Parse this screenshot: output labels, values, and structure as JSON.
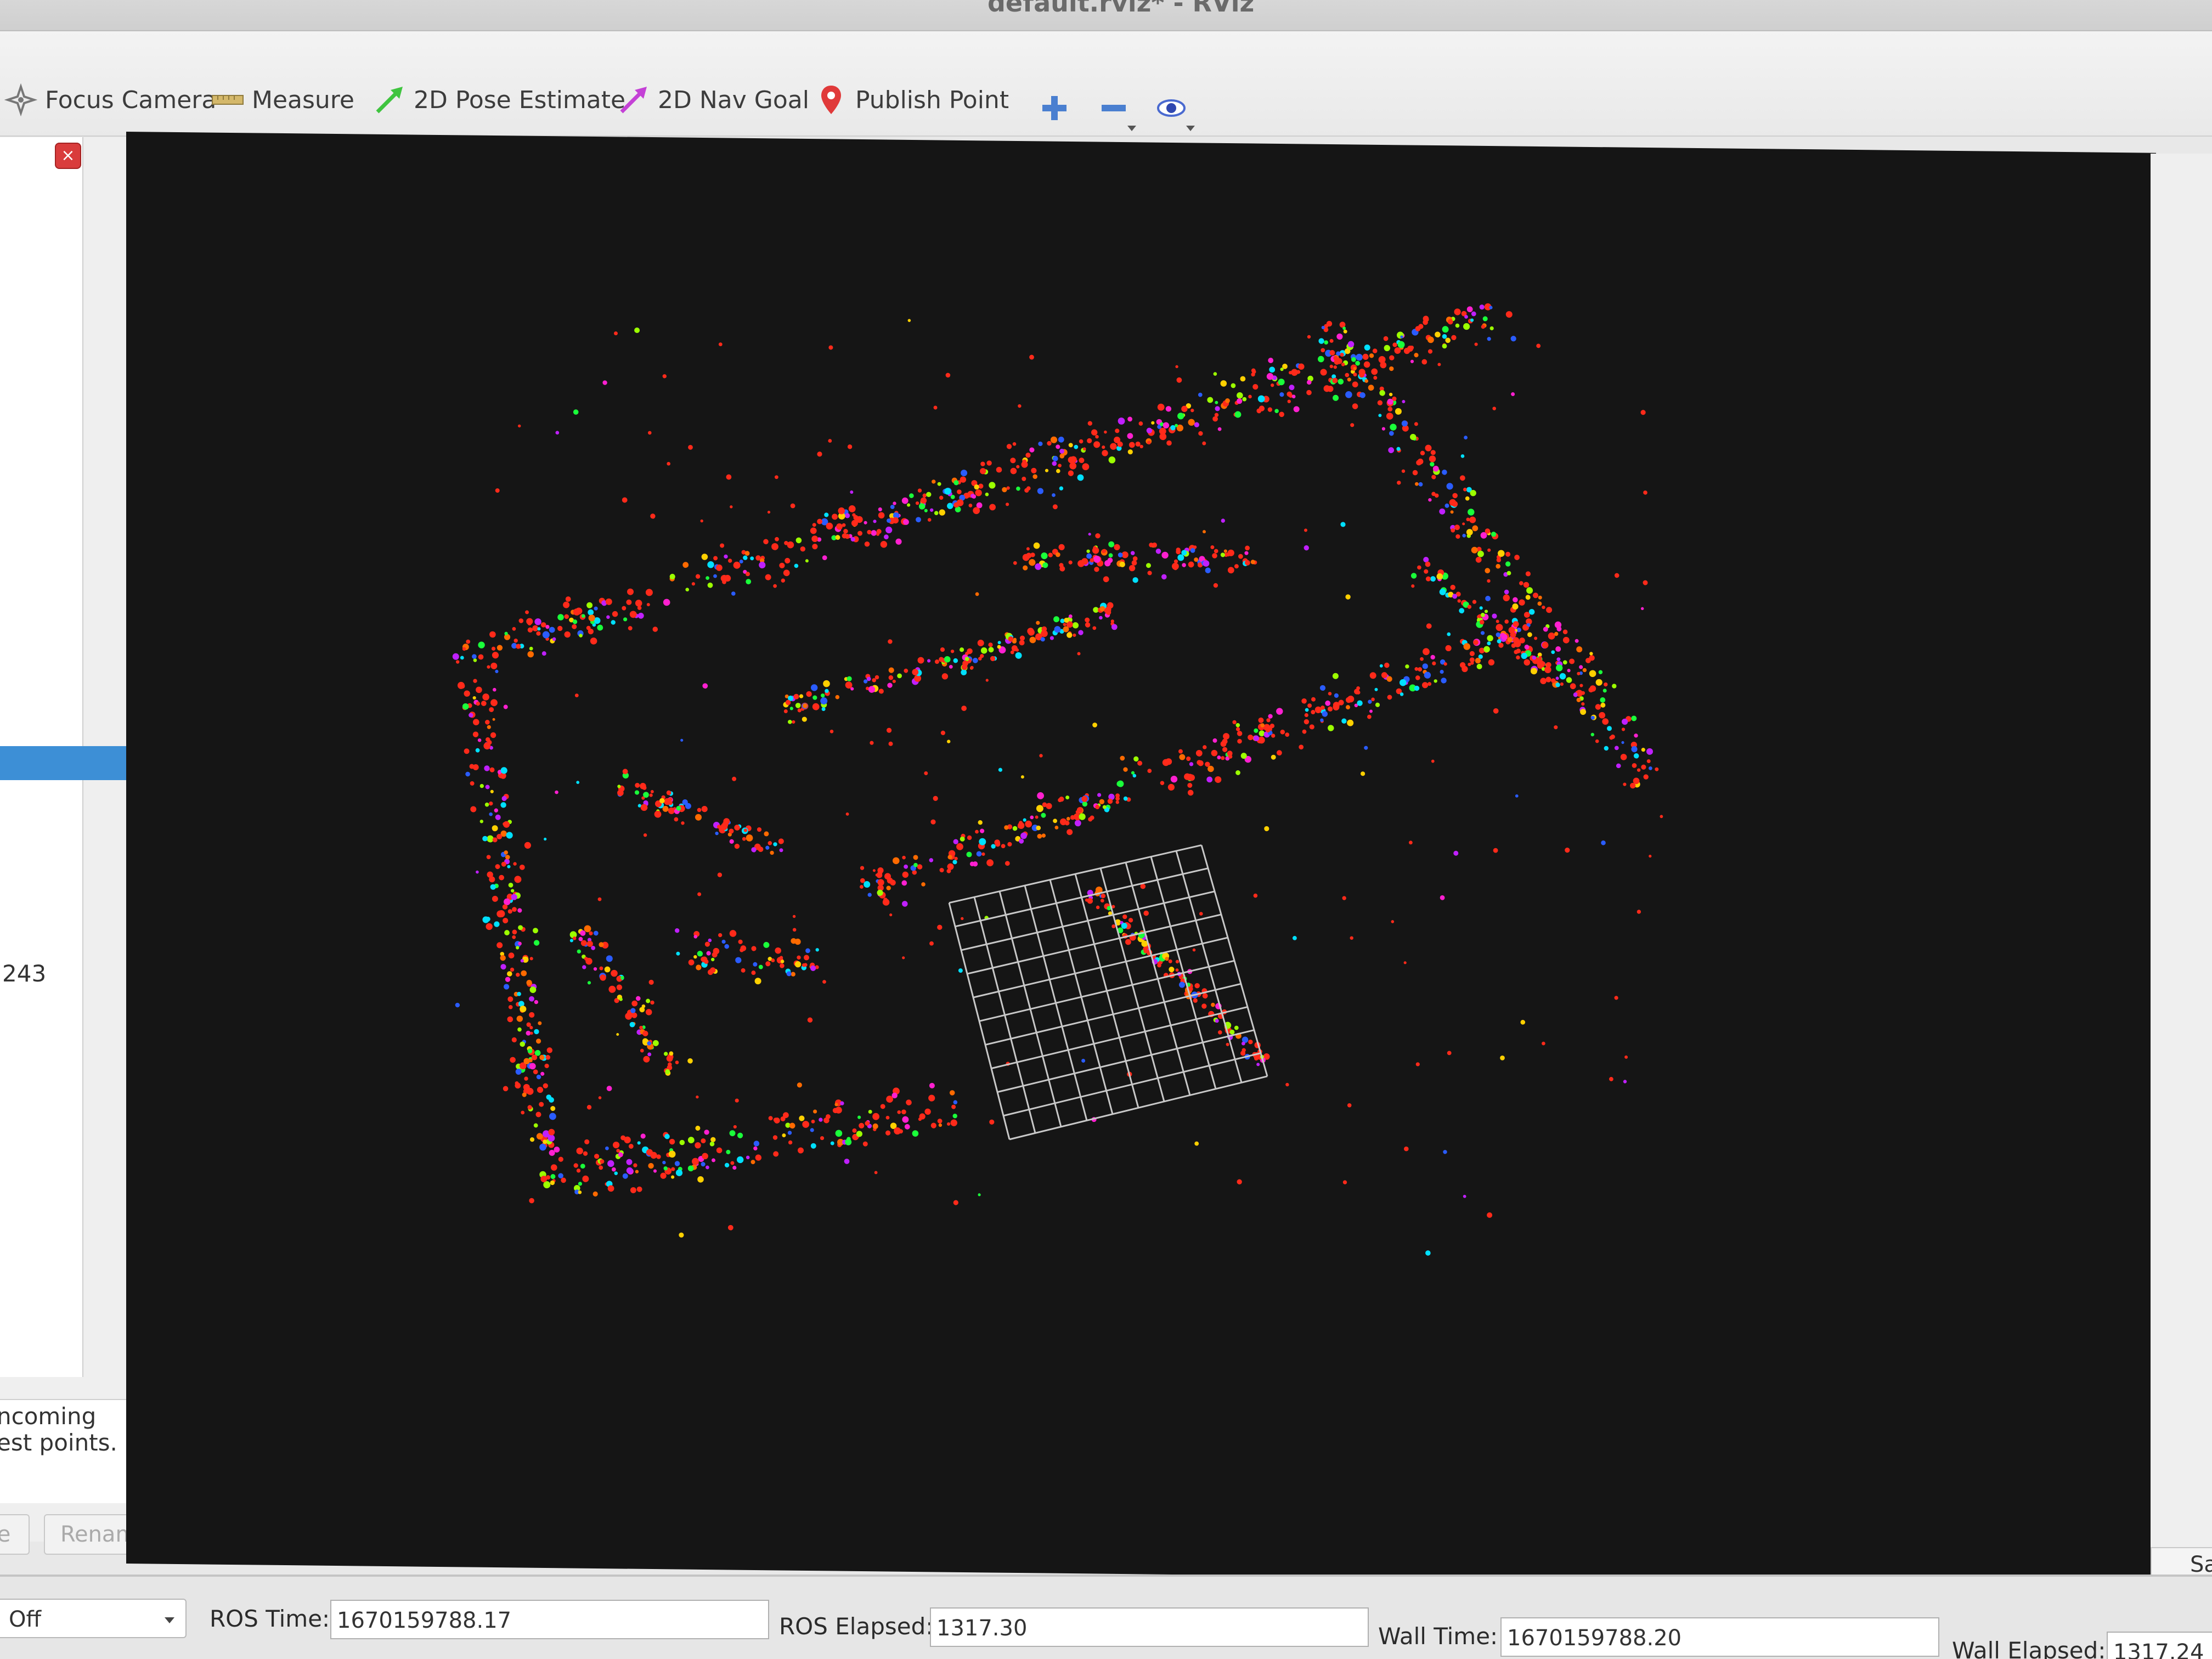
{
  "window": {
    "title": "default.rviz* - RViz"
  },
  "toolbar": {
    "focus_camera": "Focus Camera",
    "measure": "Measure",
    "pose_estimate": "2D Pose Estimate",
    "nav_goal": "2D Nav Goal",
    "publish_point": "Publish Point",
    "icons": [
      "move-camera-icon",
      "zoom-in-icon",
      "zoom-out-icon",
      "eye-icon"
    ]
  },
  "left_panel": {
    "value": "243",
    "description_line1": "ncoming",
    "description_line2": "est points.",
    "button_left": "e",
    "button_rename": "Rename"
  },
  "right_panel": {
    "save_button": "Sa"
  },
  "time_bar": {
    "sync_mode": "Off",
    "ros_time_label": "ROS Time:",
    "ros_time_value": "1670159788.17",
    "ros_elapsed_label": "ROS Elapsed:",
    "ros_elapsed_value": "1317.30",
    "wall_time_label": "Wall Time:",
    "wall_time_value": "1670159788.20",
    "wall_elapsed_label": "Wall Elapsed:",
    "wall_elapsed_value": "1317.24"
  },
  "colors": {
    "viewport_bg": "#151515",
    "grid": "#c8c8c8",
    "selection": "#3d8fd6",
    "point_palette": [
      "#ff2a1a",
      "#ff6a00",
      "#ffd000",
      "#9cff00",
      "#1aff3a",
      "#00e0ff",
      "#2a5cff",
      "#c020ff",
      "#ff20d0"
    ]
  }
}
